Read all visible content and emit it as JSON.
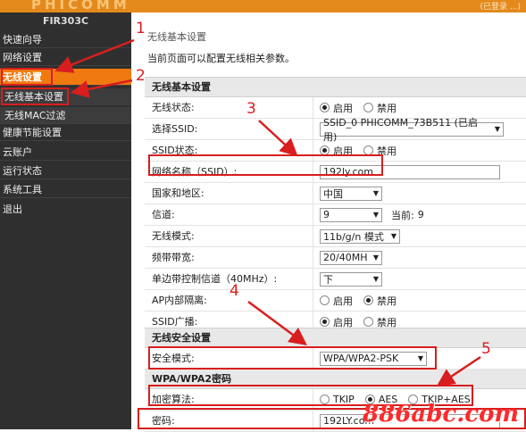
{
  "header": {
    "brand": "PHICOMM",
    "right_info": "(已登录 ...)"
  },
  "sidebar": {
    "model": "FIR303C",
    "items": [
      {
        "label": "快速向导"
      },
      {
        "label": "网络设置"
      },
      {
        "label": "无线设置"
      },
      {
        "label": "无线基本设置"
      },
      {
        "label": "无线MAC过滤"
      },
      {
        "label": "健康节能设置"
      },
      {
        "label": "云账户"
      },
      {
        "label": "运行状态"
      },
      {
        "label": "系统工具"
      },
      {
        "label": "退出"
      }
    ]
  },
  "main": {
    "breadcrumb": "无线基本设置",
    "description": "当前页面可以配置无线相关参数。",
    "basic": {
      "title": "无线基本设置",
      "wireless_status": {
        "label": "无线状态:",
        "opt_on": "启用",
        "opt_off": "禁用"
      },
      "select_ssid": {
        "label": "选择SSID:",
        "value": "SSID_0 PHICOMM_73B511 (已启用)"
      },
      "ssid_status": {
        "label": "SSID状态:",
        "opt_on": "启用",
        "opt_off": "禁用"
      },
      "network_name": {
        "label": "网络名称（SSID）:",
        "value": "192ly.com"
      },
      "region": {
        "label": "国家和地区:",
        "value": "中国"
      },
      "channel": {
        "label": "信道:",
        "value": "9",
        "current_label": "当前:",
        "current_value": "9"
      },
      "mode": {
        "label": "无线模式:",
        "value": "11b/g/n 模式"
      },
      "bandwidth": {
        "label": "频带带宽:",
        "value": "20/40MH"
      },
      "sideband": {
        "label": "单边带控制信道（40MHz）:",
        "value": "下"
      },
      "ap_isolation": {
        "label": "AP内部隔离:",
        "opt_on": "启用",
        "opt_off": "禁用"
      },
      "ssid_broadcast": {
        "label": "SSID广播:",
        "opt_on": "启用",
        "opt_off": "禁用"
      }
    },
    "security": {
      "title": "无线安全设置",
      "mode": {
        "label": "安全模式:",
        "value": "WPA/WPA2-PSK"
      }
    },
    "wpa": {
      "title": "WPA/WPA2密码",
      "cipher": {
        "label": "加密算法:",
        "opt1": "TKIP",
        "opt2": "AES",
        "opt3": "TKIP+AES"
      },
      "password": {
        "label": "密码:",
        "value": "192LY.com"
      }
    }
  },
  "annotations": {
    "n1": "1",
    "n2": "2",
    "n3": "3",
    "n4": "4",
    "n5": "5"
  },
  "watermark": "886abc.com",
  "colors": {
    "accent": "#f07a10",
    "sidebar_bg": "#2f2f2f",
    "annotation": "#d81e1e"
  },
  "icons": {
    "select_arrow": "chevron-down-icon",
    "radio": "radio-icon"
  }
}
